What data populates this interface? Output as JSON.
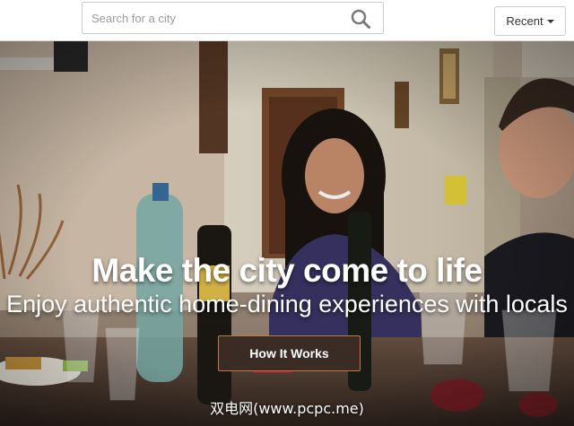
{
  "header": {
    "search": {
      "placeholder": "Search for a city",
      "value": ""
    },
    "recent_label": "Recent"
  },
  "hero": {
    "headline": "Make the city come to life",
    "subheadline": "Enjoy authentic home-dining experiences with locals",
    "cta_label": "How It Works"
  },
  "watermark": "双电网(www.pcpc.me)",
  "icons": {
    "search": "search-icon",
    "recent_caret": "caret-down-icon"
  },
  "colors": {
    "cta_background": "#3a2b24",
    "cta_border": "#c8763b",
    "headline_text": "#ffffff"
  }
}
